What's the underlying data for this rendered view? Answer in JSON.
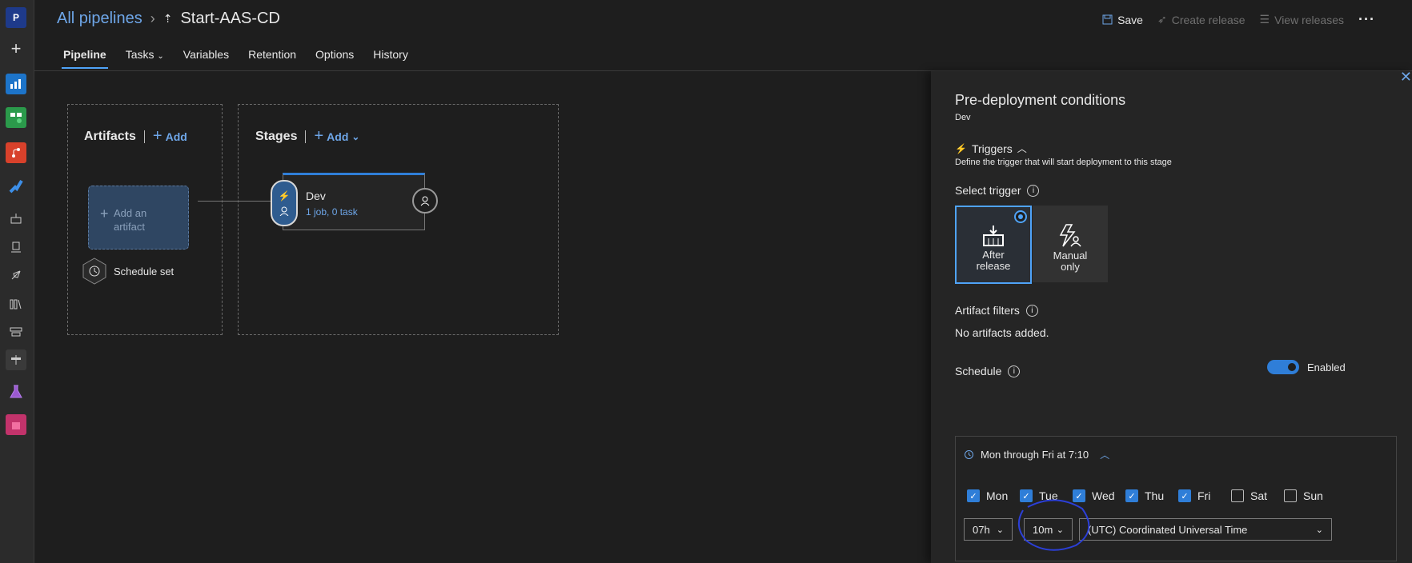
{
  "breadcrumb": {
    "all_pipelines": "All pipelines",
    "pipeline_name": "Start-AAS-CD"
  },
  "actions": {
    "save": "Save",
    "create_release": "Create release",
    "view_releases": "View releases",
    "more": "···"
  },
  "tabs": [
    "Pipeline",
    "Tasks",
    "Variables",
    "Retention",
    "Options",
    "History"
  ],
  "rail": {
    "project_initial": "P"
  },
  "canvas": {
    "artifacts_label": "Artifacts",
    "artifacts_add": "Add",
    "artifact_placeholder_line1": "Add an",
    "artifact_placeholder_line2": "artifact",
    "schedule_set": "Schedule set",
    "stages_label": "Stages",
    "stages_add": "Add",
    "stage": {
      "name": "Dev",
      "summary": "1 job, 0 task"
    }
  },
  "panel": {
    "title": "Pre-deployment conditions",
    "stage_name": "Dev",
    "triggers_label": "Triggers",
    "triggers_desc": "Define the trigger that will start deployment to this stage",
    "select_trigger_label": "Select trigger",
    "trigger_options": [
      {
        "line1": "After",
        "line2": "release",
        "selected": true
      },
      {
        "line1": "Manual",
        "line2": "only",
        "selected": false
      }
    ],
    "artifact_filters_label": "Artifact filters",
    "no_artifacts": "No artifacts added.",
    "schedule_label": "Schedule",
    "schedule_toggle": "Enabled",
    "schedule_summary": "Mon through Fri at 7:10",
    "days": [
      {
        "label": "Mon",
        "checked": true
      },
      {
        "label": "Tue",
        "checked": true
      },
      {
        "label": "Wed",
        "checked": true
      },
      {
        "label": "Thu",
        "checked": true
      },
      {
        "label": "Fri",
        "checked": true
      },
      {
        "label": "Sat",
        "checked": false
      },
      {
        "label": "Sun",
        "checked": false
      }
    ],
    "hour": "07h",
    "minute": "10m",
    "timezone": "(UTC) Coordinated Universal Time"
  }
}
